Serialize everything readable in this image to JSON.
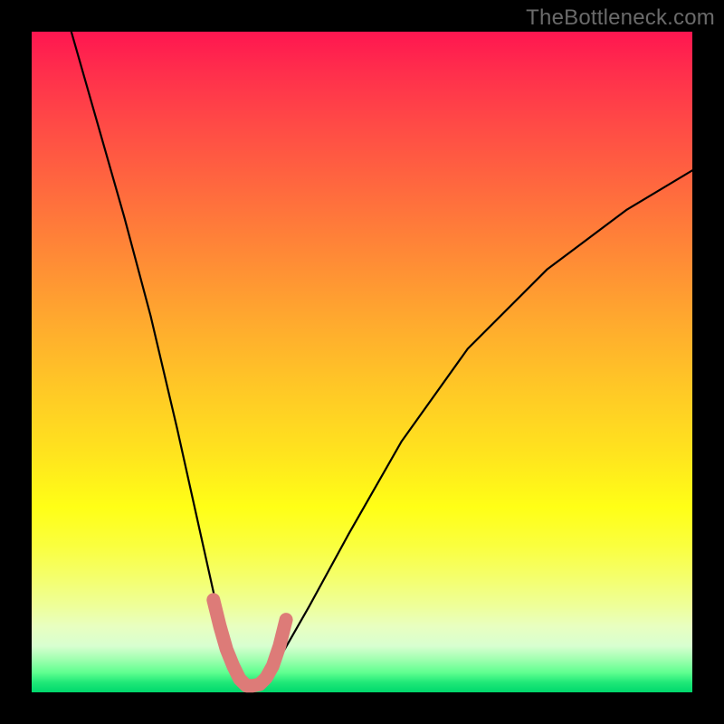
{
  "watermark": "TheBottleneck.com",
  "chart_data": {
    "type": "line",
    "title": "",
    "xlabel": "",
    "ylabel": "",
    "xlim": [
      0,
      100
    ],
    "ylim": [
      0,
      100
    ],
    "grid": false,
    "legend": false,
    "series": [
      {
        "name": "bottleneck-curve",
        "color": "#000000",
        "x": [
          6,
          10,
          14,
          18,
          22,
          24,
          26,
          28,
          29,
          30,
          31,
          32,
          33,
          34,
          35,
          36,
          38,
          42,
          48,
          56,
          66,
          78,
          90,
          100
        ],
        "values": [
          100,
          86,
          72,
          57,
          40,
          31,
          22,
          13,
          9,
          6,
          3,
          1.5,
          1,
          1,
          1.5,
          3,
          6,
          13,
          24,
          38,
          52,
          64,
          73,
          79
        ]
      },
      {
        "name": "highlight-valley",
        "color": "#dd7b78",
        "x": [
          27.5,
          28.5,
          29.5,
          30.5,
          31.5,
          32.5,
          33.5,
          34.5,
          35.5,
          36.5,
          37.5,
          38.5
        ],
        "values": [
          14,
          10,
          6.5,
          4,
          2,
          1,
          1,
          1.2,
          2.2,
          4,
          7,
          11
        ]
      }
    ],
    "notes": "No visible axis ticks, labels, title, or legend. Watermark text in top-right. Background is a vertical traffic-light gradient (red→yellow→green). Values estimated from pixel positions; y=0 at bottom, y=100 at top; x=0 at left, x=100 at right of the colored plot area."
  }
}
